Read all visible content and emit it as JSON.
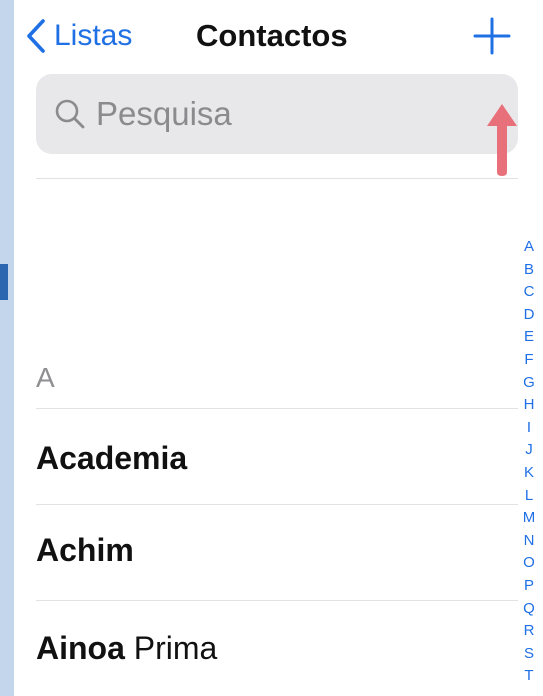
{
  "nav": {
    "back_label": "Listas",
    "title": "Contactos",
    "add_icon": "plus-icon",
    "back_icon": "chevron-left-icon"
  },
  "search": {
    "placeholder": "Pesquisa",
    "icon": "search-icon"
  },
  "annotation": {
    "icon": "up-arrow-icon",
    "color": "#e8707a"
  },
  "section": {
    "header": "A"
  },
  "contacts": [
    {
      "first": "Academia",
      "last": ""
    },
    {
      "first": "Achim",
      "last": ""
    },
    {
      "first": "Ainoa",
      "last": "Prima"
    }
  ],
  "index_letters": [
    "A",
    "B",
    "C",
    "D",
    "E",
    "F",
    "G",
    "H",
    "I",
    "J",
    "K",
    "L",
    "M",
    "N",
    "O",
    "P",
    "Q",
    "R",
    "S",
    "T"
  ],
  "colors": {
    "accent": "#1f6fe5",
    "search_bg": "#e8e8ea",
    "secondary_text": "#8e8e93"
  }
}
